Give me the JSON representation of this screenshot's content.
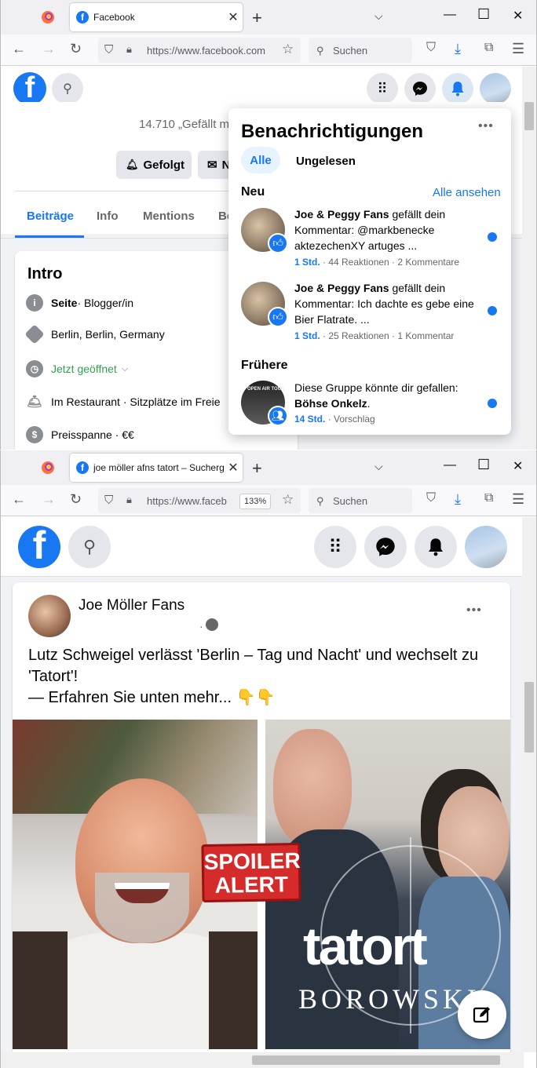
{
  "window1": {
    "tab_title": "Facebook",
    "url": "https://www.facebook.com",
    "search_placeholder": "Suchen",
    "page": {
      "likes_text": "14.710 „Gefällt mi",
      "followed_button": "Gefolgt",
      "message_button_partial": "N",
      "tabs": [
        "Beiträge",
        "Info",
        "Mentions",
        "Be"
      ],
      "intro": {
        "title": "Intro",
        "page_label": "Seite",
        "page_category": " · Blogger/in",
        "location": "Berlin, Berlin, Germany",
        "open_status": "Jetzt geöffnet",
        "service": "Im Restaurant · Sitzplätze im Freie",
        "price": "Preisspanne · €€"
      }
    },
    "notifications": {
      "title": "Benachrichtigungen",
      "filter_all": "Alle",
      "filter_unread": "Ungelesen",
      "section_new": "Neu",
      "see_all": "Alle ansehen",
      "section_earlier": "Frühere",
      "items": [
        {
          "name": "Joe & Peggy Fans",
          "text": " gefällt dein Kommentar: @markbenecke aktezechenXY artuges ...",
          "time": "1 Std.",
          "meta": " · 44 Reaktionen · 2 Kommentare"
        },
        {
          "name": "Joe & Peggy Fans",
          "text": " gefällt dein Kommentar: Ich dachte es gebe eine Bier Flatrate. ...",
          "time": "1 Std.",
          "meta": " · 25 Reaktionen · 1 Kommentar"
        },
        {
          "text": "Diese Gruppe könnte dir gefallen: ",
          "bold": "Böhse Onkelz",
          "after": ".",
          "time": "14 Std.",
          "meta": " · Vorschlag",
          "thumb_text": "OPEN AIR TOUR"
        }
      ]
    }
  },
  "window2": {
    "tab_title": "joe möller afns tatort – Sucherg",
    "url": "https://www.faceb",
    "zoom": "133%",
    "search_placeholder": "Suchen",
    "post": {
      "author": "Joe Möller Fans",
      "dot": "·",
      "line1": "Lutz Schweigel verlässt 'Berlin – Tag und Nacht' und wechselt zu",
      "line2": "'Tatort'!",
      "line3": "— Erfahren Sie unten mehr... 👇👇",
      "tatort_logo": "tatort",
      "borowski": "BOROWSKI",
      "spoiler1": "SPOILER",
      "spoiler2": "ALERT"
    }
  },
  "icons": {
    "back": "←",
    "forward": "→",
    "reload": "↻",
    "star": "☆",
    "more": "•••",
    "close": "✕"
  },
  "colors": {
    "brand": "#1877f2",
    "green_status": "#31a24c"
  }
}
